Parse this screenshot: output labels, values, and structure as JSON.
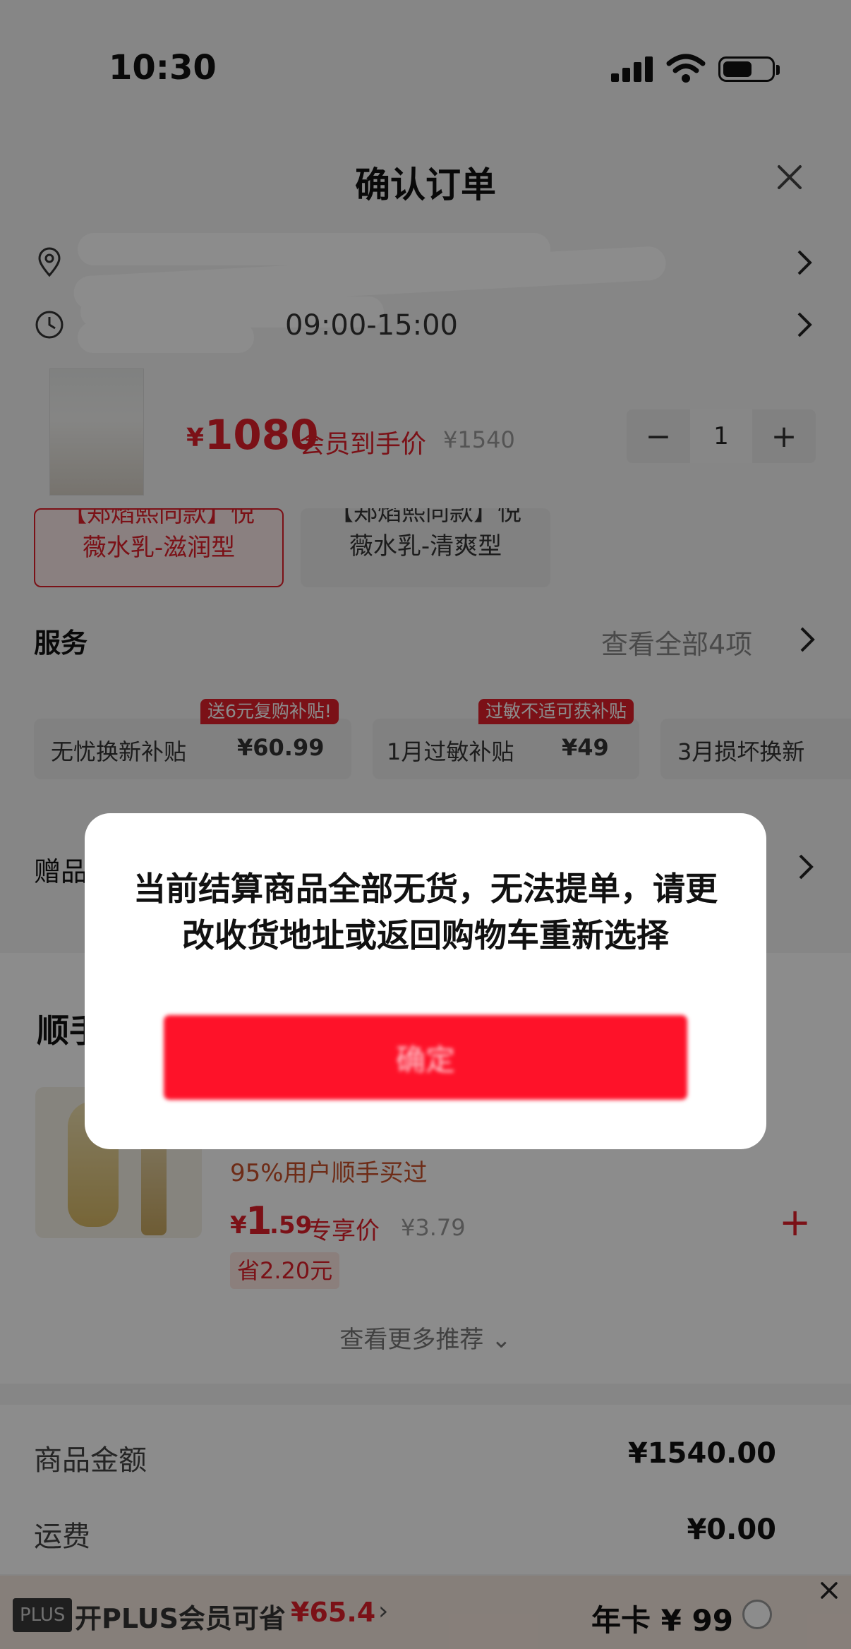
{
  "status_bar": {
    "time": "10:30"
  },
  "header": {
    "title": "确认订单"
  },
  "address": {
    "time_slot": "09:00-15:00"
  },
  "product": {
    "price_symbol": "¥",
    "price": "1080",
    "price_label": "会员到手价",
    "original_price": "¥1540",
    "quantity": "1",
    "minus_label": "−",
    "plus_label": "+"
  },
  "variants": [
    {
      "top": "【郑焰熙同款】悦",
      "bottom": "薇水乳-滋润型"
    },
    {
      "top": "【郑焰熙同款】悦",
      "bottom": "薇水乳-清爽型"
    }
  ],
  "services": {
    "title": "服务",
    "more": "查看全部4项",
    "items": [
      {
        "name": "无忧换新补贴",
        "price": "¥60.99",
        "badge": "送6元复购补贴!"
      },
      {
        "name": "1月过敏补贴",
        "price": "¥49",
        "badge": "过敏不适可获补贴"
      },
      {
        "name": "3月损坏换新",
        "price": "",
        "badge": ""
      }
    ]
  },
  "gifts": {
    "label": "赠品"
  },
  "recommend": {
    "title": "顺手",
    "buyers": "95%用户顺手买过",
    "price_symbol": "¥",
    "price_int": "1",
    "price_dec": ".59",
    "price_label": "专享价",
    "original_price": "¥3.79",
    "save": "省2.20元",
    "add_label": "+",
    "more": "查看更多推荐 ⌄"
  },
  "summary": {
    "rows": [
      {
        "label": "商品金额",
        "value": "¥1540.00"
      },
      {
        "label": "运费",
        "value": "¥0.00"
      }
    ]
  },
  "plus_bar": {
    "badge": "PLUS",
    "text": "开PLUS会员可省",
    "amount": "¥65.4",
    "chevron": "›",
    "price": "年卡 ¥ 99"
  },
  "dialog": {
    "message": "当前结算商品全部无货，无法提单，请更改收货地址或返回购物车重新选择",
    "confirm_label": "确定"
  },
  "colors": {
    "accent": "#e0202a",
    "confirm_button": "#fe1229"
  }
}
